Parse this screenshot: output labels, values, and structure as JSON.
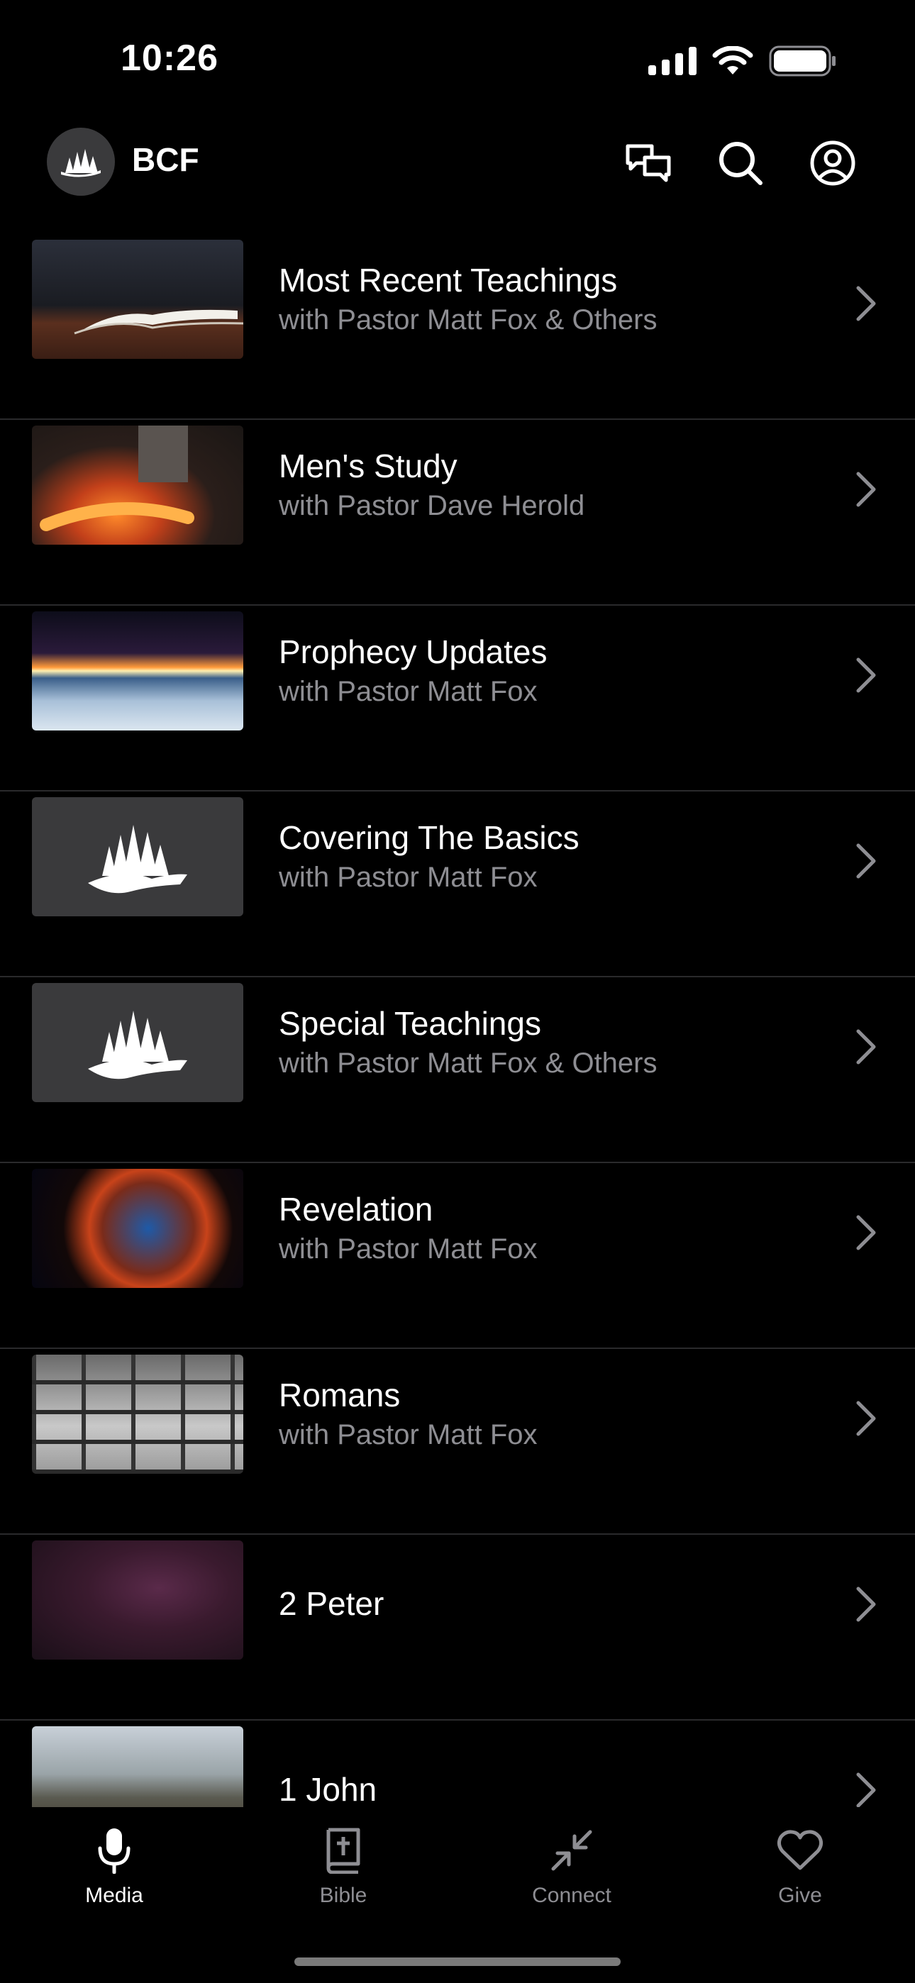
{
  "status_bar": {
    "time": "10:26"
  },
  "header": {
    "app_name": "BCF",
    "logo_icon": "bcf-trees-logo-icon",
    "actions": [
      "chat-icon",
      "search-icon",
      "account-icon"
    ]
  },
  "list": {
    "items": [
      {
        "title": "Most Recent Teachings",
        "subtitle": "with Pastor Matt Fox & Others"
      },
      {
        "title": "Men's Study",
        "subtitle": "with Pastor Dave Herold"
      },
      {
        "title": "Prophecy Updates",
        "subtitle": "with Pastor Matt Fox"
      },
      {
        "title": "Covering The Basics",
        "subtitle": "with Pastor Matt Fox"
      },
      {
        "title": "Special Teachings",
        "subtitle": "with Pastor Matt Fox & Others"
      },
      {
        "title": "Revelation",
        "subtitle": "with Pastor Matt Fox"
      },
      {
        "title": "Romans",
        "subtitle": "with Pastor Matt Fox"
      },
      {
        "title": "2 Peter",
        "subtitle": ""
      },
      {
        "title": "1 John",
        "subtitle": ""
      }
    ]
  },
  "tab_bar": {
    "tabs": [
      {
        "label": "Media",
        "icon": "microphone-icon",
        "active": true
      },
      {
        "label": "Bible",
        "icon": "bible-icon",
        "active": false
      },
      {
        "label": "Connect",
        "icon": "connect-arrows-icon",
        "active": false
      },
      {
        "label": "Give",
        "icon": "heart-icon",
        "active": false
      }
    ]
  },
  "colors": {
    "background": "#000000",
    "subtitle": "#8e8e93",
    "divider": "#2a2a2c",
    "tab_inactive": "#8e8e93"
  }
}
